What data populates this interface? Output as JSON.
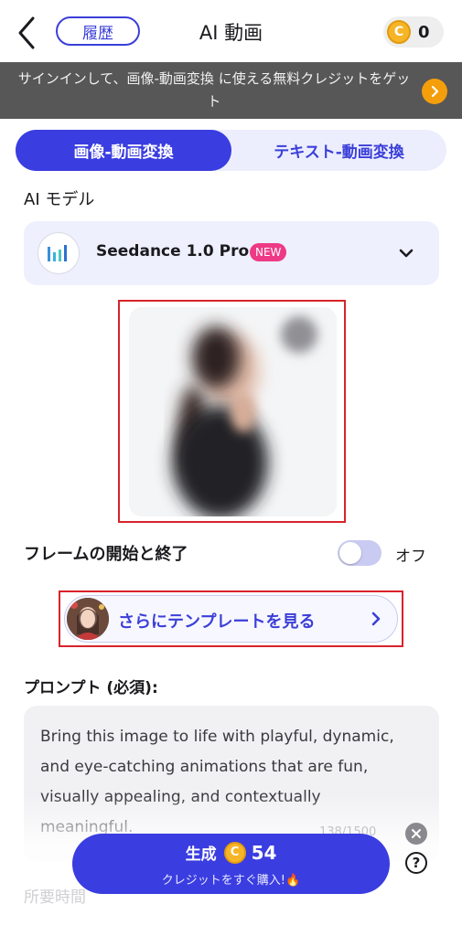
{
  "header": {
    "history_label": "履歴",
    "title": "AI 動画",
    "credits": "0",
    "coin_glyph": "C"
  },
  "banner": {
    "text": "サインインして、画像-動画変換 に使える無料クレジットをゲット"
  },
  "tabs": [
    {
      "label": "画像-動画変換",
      "active": true
    },
    {
      "label": "テキスト-動画変換",
      "active": false
    }
  ],
  "model": {
    "section_label": "AI モデル",
    "name": "Seedance 1.0 Pro",
    "badge": "NEW"
  },
  "frames": {
    "label": "フレームの開始と終了",
    "toggle_state": "オフ",
    "enabled": false
  },
  "templates": {
    "label": "さらにテンプレートを見る"
  },
  "prompt": {
    "label": "プロンプト (必須):",
    "text": "Bring this image to life with playful, dynamic, and eye-catching animations that are fun, visually appealing, and contextually meaningful.",
    "count": "138/1500"
  },
  "duration": {
    "label": "所要時間"
  },
  "generate": {
    "label": "生成",
    "coin_glyph": "C",
    "cost": "54",
    "sub_label": "クレジットをすぐ購入!🔥"
  },
  "colors": {
    "accent": "#3a3de0",
    "banner_bg": "#575757",
    "highlight_border": "#d8232a",
    "coin": "#f6b526",
    "badge": "#ee3a86"
  }
}
